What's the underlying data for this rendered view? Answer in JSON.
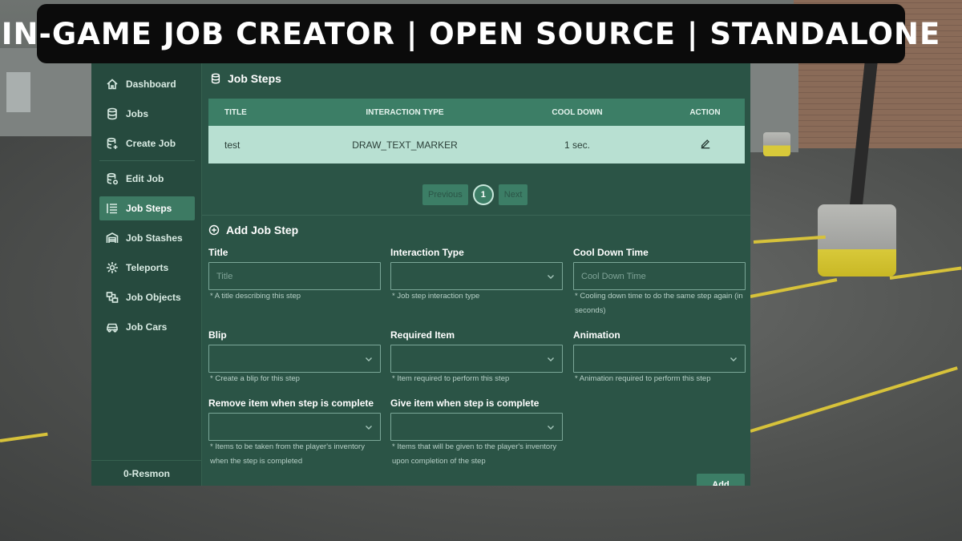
{
  "banner": {
    "title": "IN-GAME JOB CREATOR | OPEN SOURCE | STANDALONE"
  },
  "sidebar": {
    "items": [
      {
        "label": "Dashboard",
        "icon": "home-icon"
      },
      {
        "label": "Jobs",
        "icon": "database-icon"
      },
      {
        "label": "Create Job",
        "icon": "database-plus-icon"
      },
      {
        "label": "Edit Job",
        "icon": "database-gear-icon"
      },
      {
        "label": "Job Steps",
        "icon": "list-icon",
        "active": true
      },
      {
        "label": "Job Stashes",
        "icon": "warehouse-icon"
      },
      {
        "label": "Teleports",
        "icon": "teleport-icon"
      },
      {
        "label": "Job Objects",
        "icon": "objects-icon"
      },
      {
        "label": "Job Cars",
        "icon": "car-icon"
      }
    ],
    "footer": "0-Resmon"
  },
  "job_steps": {
    "title": "Job Steps",
    "columns": {
      "title": "Title",
      "interaction_type": "Interaction Type",
      "cool_down": "Cool Down",
      "action": "Action"
    },
    "rows": [
      {
        "title": "test",
        "interaction_type": "DRAW_TEXT_MARKER",
        "cool_down": "1 sec."
      }
    ],
    "pagination": {
      "previous": "Previous",
      "page": "1",
      "next": "Next"
    }
  },
  "add_step": {
    "title": "Add Job Step",
    "fields": {
      "title": {
        "label": "Title",
        "placeholder": "Title",
        "hint": "* A title describing this step"
      },
      "interaction_type": {
        "label": "Interaction Type",
        "hint": "* Job step interaction type"
      },
      "cool_down": {
        "label": "Cool Down Time",
        "placeholder": "Cool Down Time",
        "hint": "* Cooling down time to do the same step again (in seconds)"
      },
      "blip": {
        "label": "Blip",
        "hint": "* Create a blip for this step"
      },
      "required_item": {
        "label": "Required Item",
        "hint": "* Item required to perform this step"
      },
      "animation": {
        "label": "Animation",
        "hint": "* Animation required to perform this step"
      },
      "remove_item": {
        "label": "Remove item when step is complete",
        "hint": "* Items to be taken from the player's inventory when the step is completed"
      },
      "give_item": {
        "label": "Give item when step is complete",
        "hint": "* Items that will be given to the player's inventory upon completion of the step"
      }
    },
    "add_label": "Add"
  }
}
